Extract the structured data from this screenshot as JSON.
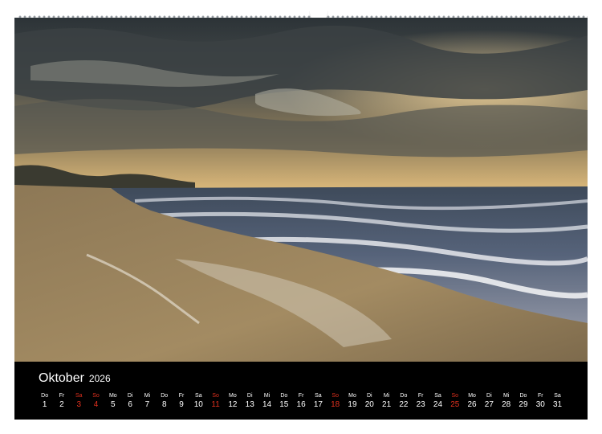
{
  "calendar": {
    "month": "Oktober",
    "year": "2026",
    "weekend_color": "#e0301e",
    "days": [
      {
        "wd": "Do",
        "d": "1",
        "w": false
      },
      {
        "wd": "Fr",
        "d": "2",
        "w": false
      },
      {
        "wd": "Sa",
        "d": "3",
        "w": true
      },
      {
        "wd": "So",
        "d": "4",
        "w": true
      },
      {
        "wd": "Mo",
        "d": "5",
        "w": false
      },
      {
        "wd": "Di",
        "d": "6",
        "w": false
      },
      {
        "wd": "Mi",
        "d": "7",
        "w": false
      },
      {
        "wd": "Do",
        "d": "8",
        "w": false
      },
      {
        "wd": "Fr",
        "d": "9",
        "w": false
      },
      {
        "wd": "Sa",
        "d": "10",
        "w": false
      },
      {
        "wd": "So",
        "d": "11",
        "w": true
      },
      {
        "wd": "Mo",
        "d": "12",
        "w": false
      },
      {
        "wd": "Di",
        "d": "13",
        "w": false
      },
      {
        "wd": "Mi",
        "d": "14",
        "w": false
      },
      {
        "wd": "Do",
        "d": "15",
        "w": false
      },
      {
        "wd": "Fr",
        "d": "16",
        "w": false
      },
      {
        "wd": "Sa",
        "d": "17",
        "w": false
      },
      {
        "wd": "So",
        "d": "18",
        "w": true
      },
      {
        "wd": "Mo",
        "d": "19",
        "w": false
      },
      {
        "wd": "Di",
        "d": "20",
        "w": false
      },
      {
        "wd": "Mi",
        "d": "21",
        "w": false
      },
      {
        "wd": "Do",
        "d": "22",
        "w": false
      },
      {
        "wd": "Fr",
        "d": "23",
        "w": false
      },
      {
        "wd": "Sa",
        "d": "24",
        "w": false
      },
      {
        "wd": "So",
        "d": "25",
        "w": true
      },
      {
        "wd": "Mo",
        "d": "26",
        "w": false
      },
      {
        "wd": "Di",
        "d": "27",
        "w": false
      },
      {
        "wd": "Mi",
        "d": "28",
        "w": false
      },
      {
        "wd": "Do",
        "d": "29",
        "w": false
      },
      {
        "wd": "Fr",
        "d": "30",
        "w": false
      },
      {
        "wd": "Sa",
        "d": "31",
        "w": false
      }
    ]
  }
}
